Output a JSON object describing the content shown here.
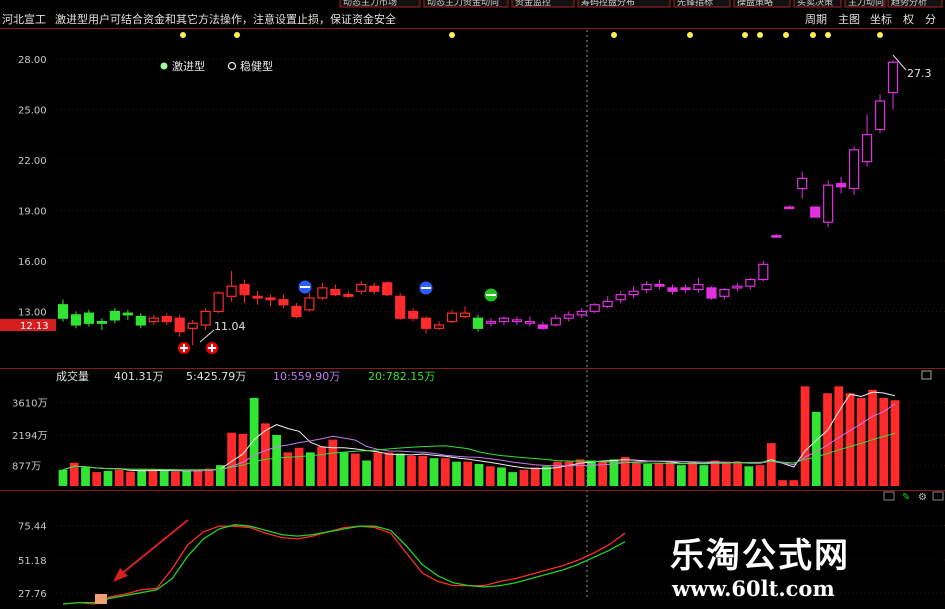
{
  "stock_name": "河北宣工",
  "warning_text": "激进型用户可结合资金和其它方法操作，注意设置止损，保证资金安全",
  "toolbar_buttons": [
    "动态主力市场",
    "动态主力资金动向",
    "资金监控",
    "筹码控盘分布",
    "先锋指标",
    "操盘策略",
    "买卖决策",
    "主力动向",
    "趋势分析"
  ],
  "period_tabs": [
    "周期",
    "主图",
    "坐标",
    "权",
    "分"
  ],
  "price_axis": [
    "28.00",
    "25.00",
    "22.00",
    "19.00",
    "16.00",
    "13.00"
  ],
  "current_price_tag": "12.13",
  "legend": {
    "aggressive": "激进型",
    "steady": "稳健型"
  },
  "annotations": {
    "low_price": "11.04",
    "high_price": "27.3"
  },
  "volume_header": {
    "title": "成交量",
    "vol": "401.31万",
    "ma5": "5:425.79万",
    "ma10": "10:559.90万",
    "ma20": "20:782.15万"
  },
  "volume_axis": [
    "3610万",
    "2194万",
    "877万"
  ],
  "indicator_axis": [
    "75.44",
    "51.18",
    "27.76"
  ],
  "watermark": {
    "title": "乐淘公式网",
    "url": "www.60lt.com"
  },
  "colors": {
    "up": "#ff2a2a",
    "down": "#33e533",
    "magenta": "#e030e0",
    "cyan_box": "#20ffff",
    "grid": "#8b1a1a",
    "axis_text": "#c8c8c8"
  },
  "chart_data": [
    {
      "type": "candlestick",
      "title": "",
      "ylim": [
        10,
        29
      ],
      "ticks": [
        28,
        25,
        22,
        19,
        16,
        13
      ],
      "candles": [
        {
          "o": 12.6,
          "c": 13.4,
          "h": 13.7,
          "l": 12.4,
          "col": "down"
        },
        {
          "o": 12.8,
          "c": 12.2,
          "h": 13.0,
          "l": 12.0,
          "col": "down"
        },
        {
          "o": 12.9,
          "c": 12.3,
          "h": 13.1,
          "l": 12.1,
          "col": "down"
        },
        {
          "o": 12.4,
          "c": 12.3,
          "h": 12.6,
          "l": 11.9,
          "col": "down"
        },
        {
          "o": 12.5,
          "c": 13.0,
          "h": 13.2,
          "l": 12.3,
          "col": "down"
        },
        {
          "o": 12.8,
          "c": 12.9,
          "h": 13.1,
          "l": 12.5,
          "col": "down"
        },
        {
          "o": 12.7,
          "c": 12.2,
          "h": 12.9,
          "l": 12.0,
          "col": "down"
        },
        {
          "o": 12.4,
          "c": 12.6,
          "h": 12.8,
          "l": 12.2,
          "col": "up"
        },
        {
          "o": 12.7,
          "c": 12.4,
          "h": 12.9,
          "l": 12.2,
          "col": "up"
        },
        {
          "o": 12.6,
          "c": 11.8,
          "h": 12.8,
          "l": 11.5,
          "col": "up"
        },
        {
          "o": 12.0,
          "c": 12.3,
          "h": 12.5,
          "l": 11.0,
          "col": "up"
        },
        {
          "o": 12.2,
          "c": 13.0,
          "h": 13.2,
          "l": 11.9,
          "col": "up"
        },
        {
          "o": 13.0,
          "c": 14.1,
          "h": 14.2,
          "l": 12.9,
          "col": "up"
        },
        {
          "o": 13.9,
          "c": 14.5,
          "h": 15.4,
          "l": 13.6,
          "col": "up"
        },
        {
          "o": 14.6,
          "c": 14.0,
          "h": 14.9,
          "l": 13.5,
          "col": "up"
        },
        {
          "o": 13.9,
          "c": 13.8,
          "h": 14.2,
          "l": 13.4,
          "col": "up"
        },
        {
          "o": 13.8,
          "c": 13.7,
          "h": 14.0,
          "l": 13.3,
          "col": "up"
        },
        {
          "o": 13.7,
          "c": 13.4,
          "h": 14.0,
          "l": 13.2,
          "col": "up"
        },
        {
          "o": 13.3,
          "c": 12.7,
          "h": 13.5,
          "l": 12.6,
          "col": "up"
        },
        {
          "o": 13.1,
          "c": 13.8,
          "h": 14.1,
          "l": 13.0,
          "col": "up"
        },
        {
          "o": 13.8,
          "c": 14.4,
          "h": 14.7,
          "l": 13.7,
          "col": "up"
        },
        {
          "o": 14.3,
          "c": 14.0,
          "h": 14.6,
          "l": 13.9,
          "col": "up"
        },
        {
          "o": 14.0,
          "c": 13.9,
          "h": 14.2,
          "l": 13.8,
          "col": "up"
        },
        {
          "o": 14.2,
          "c": 14.6,
          "h": 14.8,
          "l": 14.0,
          "col": "up"
        },
        {
          "o": 14.5,
          "c": 14.2,
          "h": 14.7,
          "l": 14.0,
          "col": "up"
        },
        {
          "o": 14.7,
          "c": 14.0,
          "h": 14.8,
          "l": 13.9,
          "col": "up"
        },
        {
          "o": 13.9,
          "c": 12.6,
          "h": 14.1,
          "l": 12.5,
          "col": "up"
        },
        {
          "o": 13.0,
          "c": 12.6,
          "h": 13.2,
          "l": 12.4,
          "col": "up"
        },
        {
          "o": 12.6,
          "c": 12.0,
          "h": 12.7,
          "l": 11.7,
          "col": "up"
        },
        {
          "o": 12.0,
          "c": 12.2,
          "h": 12.4,
          "l": 11.9,
          "col": "up"
        },
        {
          "o": 12.4,
          "c": 12.9,
          "h": 13.1,
          "l": 12.3,
          "col": "up"
        },
        {
          "o": 12.7,
          "c": 12.9,
          "h": 13.3,
          "l": 12.6,
          "col": "up"
        },
        {
          "o": 12.6,
          "c": 12.0,
          "h": 12.8,
          "l": 11.8,
          "col": "down"
        },
        {
          "o": 12.3,
          "c": 12.4,
          "h": 12.6,
          "l": 12.1,
          "col": "magenta"
        },
        {
          "o": 12.4,
          "c": 12.6,
          "h": 12.7,
          "l": 12.2,
          "col": "magenta"
        },
        {
          "o": 12.4,
          "c": 12.5,
          "h": 12.7,
          "l": 12.2,
          "col": "magenta"
        },
        {
          "o": 12.3,
          "c": 12.4,
          "h": 12.7,
          "l": 12.1,
          "col": "magenta"
        },
        {
          "o": 12.2,
          "c": 12.0,
          "h": 12.4,
          "l": 11.9,
          "col": "magenta"
        },
        {
          "o": 12.2,
          "c": 12.6,
          "h": 12.8,
          "l": 12.1,
          "col": "magenta"
        },
        {
          "o": 12.6,
          "c": 12.8,
          "h": 13.0,
          "l": 12.4,
          "col": "magenta"
        },
        {
          "o": 12.8,
          "c": 13.0,
          "h": 13.2,
          "l": 12.6,
          "col": "magenta"
        },
        {
          "o": 13.0,
          "c": 13.4,
          "h": 13.5,
          "l": 12.9,
          "col": "magenta"
        },
        {
          "o": 13.3,
          "c": 13.6,
          "h": 13.9,
          "l": 13.2,
          "col": "magenta"
        },
        {
          "o": 13.7,
          "c": 14.0,
          "h": 14.2,
          "l": 13.5,
          "col": "magenta"
        },
        {
          "o": 14.0,
          "c": 14.2,
          "h": 14.5,
          "l": 13.8,
          "col": "magenta"
        },
        {
          "o": 14.3,
          "c": 14.6,
          "h": 14.8,
          "l": 14.1,
          "col": "magenta"
        },
        {
          "o": 14.6,
          "c": 14.5,
          "h": 14.9,
          "l": 14.3,
          "col": "magenta"
        },
        {
          "o": 14.4,
          "c": 14.2,
          "h": 14.6,
          "l": 14.0,
          "col": "magenta"
        },
        {
          "o": 14.4,
          "c": 14.3,
          "h": 14.6,
          "l": 14.1,
          "col": "magenta"
        },
        {
          "o": 14.3,
          "c": 14.6,
          "h": 15.0,
          "l": 14.1,
          "col": "magenta"
        },
        {
          "o": 14.4,
          "c": 13.8,
          "h": 14.5,
          "l": 13.7,
          "col": "magenta"
        },
        {
          "o": 13.9,
          "c": 14.3,
          "h": 14.4,
          "l": 13.7,
          "col": "magenta"
        },
        {
          "o": 14.4,
          "c": 14.5,
          "h": 14.7,
          "l": 14.2,
          "col": "magenta"
        },
        {
          "o": 14.5,
          "c": 14.9,
          "h": 15.0,
          "l": 14.3,
          "col": "magenta"
        },
        {
          "o": 14.9,
          "c": 15.8,
          "h": 16.0,
          "l": 14.8,
          "col": "magenta"
        },
        {
          "o": 17.5,
          "c": 17.5,
          "h": 17.6,
          "l": 17.4,
          "col": "magenta"
        },
        {
          "o": 19.2,
          "c": 19.2,
          "h": 19.3,
          "l": 19.1,
          "col": "magenta"
        },
        {
          "o": 20.3,
          "c": 20.9,
          "h": 21.3,
          "l": 19.7,
          "col": "magenta"
        },
        {
          "o": 19.2,
          "c": 18.6,
          "h": 19.2,
          "l": 18.6,
          "col": "magenta"
        },
        {
          "o": 18.3,
          "c": 20.5,
          "h": 20.8,
          "l": 18.0,
          "col": "magenta"
        },
        {
          "o": 20.6,
          "c": 20.4,
          "h": 21.0,
          "l": 20.0,
          "col": "magenta"
        },
        {
          "o": 20.3,
          "c": 22.6,
          "h": 22.8,
          "l": 19.9,
          "col": "magenta"
        },
        {
          "o": 21.9,
          "c": 23.5,
          "h": 24.7,
          "l": 21.6,
          "col": "magenta"
        },
        {
          "o": 23.8,
          "c": 25.5,
          "h": 25.9,
          "l": 23.6,
          "col": "magenta"
        },
        {
          "o": 26.0,
          "c": 27.8,
          "h": 27.9,
          "l": 25.0,
          "col": "magenta"
        }
      ]
    },
    {
      "type": "bar",
      "title": "成交量",
      "ylabel": "万",
      "ylim": [
        0,
        4400
      ],
      "ticks": [
        3610,
        2194,
        877
      ],
      "values": [
        700,
        1000,
        800,
        600,
        650,
        700,
        620,
        700,
        680,
        650,
        620,
        650,
        700,
        750,
        900,
        2300,
        2250,
        3800,
        2700,
        2200,
        1450,
        1650,
        1450,
        1700,
        2000,
        1450,
        1400,
        1100,
        1450,
        1450,
        1400,
        1300,
        1300,
        1200,
        1200,
        1050,
        1050,
        950,
        850,
        800,
        600,
        700,
        800,
        850,
        1050,
        1050,
        1150,
        1100,
        1050,
        1150,
        1250,
        1000,
        950,
        1000,
        1050,
        900,
        1050,
        900,
        1100,
        1050,
        1050,
        850,
        900,
        1850,
        250,
        250,
        4300,
        3200,
        4000,
        4300,
        4000,
        3800,
        4150,
        3800,
        3700
      ],
      "colors": [
        "down",
        "up",
        "down",
        "up",
        "down",
        "up",
        "up",
        "down",
        "up",
        "down",
        "up",
        "down",
        "up",
        "up",
        "down",
        "up",
        "up",
        "down",
        "up",
        "down",
        "up",
        "up",
        "down",
        "up",
        "up",
        "down",
        "up",
        "down",
        "up",
        "up",
        "down",
        "up",
        "up",
        "down",
        "up",
        "down",
        "up",
        "down",
        "up",
        "down",
        "down",
        "up",
        "up",
        "down",
        "up",
        "up",
        "up",
        "down",
        "up",
        "down",
        "up",
        "up",
        "down",
        "up",
        "up",
        "down",
        "up",
        "down",
        "up",
        "up",
        "up",
        "down",
        "up",
        "up",
        "up",
        "up",
        "up",
        "down",
        "up",
        "up",
        "up",
        "up",
        "up",
        "up",
        "up"
      ]
    },
    {
      "type": "line",
      "ylim": [
        20,
        85
      ],
      "ticks": [
        75.44,
        51.18,
        27.76
      ],
      "series": [
        {
          "color": "red",
          "values": [
            20,
            21,
            20,
            25,
            27,
            30,
            31,
            45,
            62,
            71,
            75,
            75,
            74,
            70,
            67,
            66,
            68,
            71,
            74,
            75,
            74,
            70,
            56,
            42,
            36,
            33,
            33,
            33,
            36,
            38,
            41,
            44,
            47,
            51,
            56,
            62,
            70
          ]
        },
        {
          "color": "green",
          "values": [
            20,
            21,
            21,
            24,
            26,
            28,
            30,
            38,
            54,
            66,
            73,
            76,
            75,
            72,
            69,
            68,
            69,
            71,
            73,
            75,
            75,
            72,
            61,
            48,
            40,
            35,
            33,
            32,
            33,
            35,
            38,
            41,
            44,
            48,
            53,
            58,
            64
          ]
        }
      ]
    }
  ]
}
